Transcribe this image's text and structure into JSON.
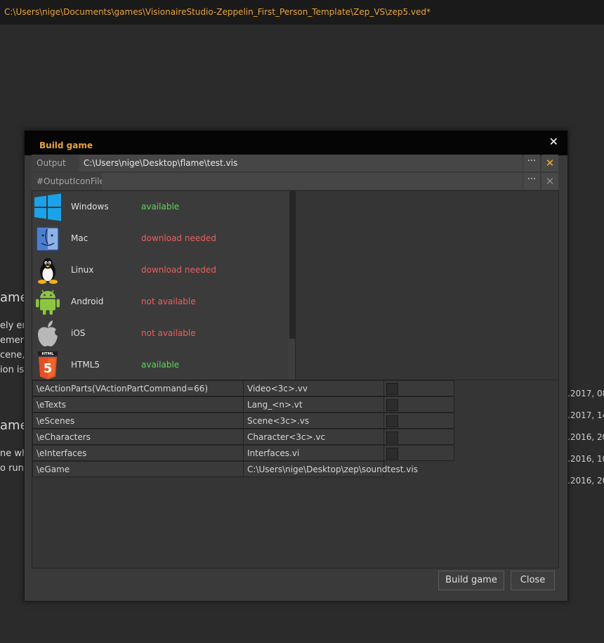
{
  "window": {
    "path": "C:\\Users\\nige\\Documents\\games\\VisionaireStudio-Zeppelin_First_Person_Template\\Zep_VS\\zep5.ved*"
  },
  "background": {
    "heading1": "ame",
    "lines1": [
      "ely em",
      "emen",
      "cene,",
      "ion is"
    ],
    "heading2": "ame",
    "lines2": [
      "ne wh",
      "o run"
    ],
    "dates": [
      ".2017, 08:",
      ".2017, 14:",
      ".2016, 20:",
      ".2016, 10:",
      ".2016, 20:"
    ]
  },
  "dialog": {
    "title": "Build game",
    "close_glyph": "✕",
    "output_file": {
      "label": "Output file",
      "value": "C:\\Users\\nige\\Desktop\\flame\\test.vis",
      "browse": "···",
      "clear": "✕"
    },
    "icon_file": {
      "label": "#OutputIconFile",
      "value": "",
      "browse": "···",
      "clear": "✕"
    },
    "platforms": [
      {
        "name": "Windows",
        "status": "available",
        "icon": "windows-icon"
      },
      {
        "name": "Mac",
        "status": "download needed",
        "icon": "mac-icon"
      },
      {
        "name": "Linux",
        "status": "download needed",
        "icon": "linux-icon"
      },
      {
        "name": "Android",
        "status": "not available",
        "icon": "android-icon"
      },
      {
        "name": "iOS",
        "status": "not available",
        "icon": "ios-icon"
      },
      {
        "name": "HTML5",
        "status": "available",
        "icon": "html5-icon"
      }
    ],
    "file_rows": [
      {
        "type": "\\eActionParts(VActionPartCommand=66)",
        "file": "Video<3c>.vv",
        "has_check": true
      },
      {
        "type": "\\eTexts",
        "file": "Lang_<n>.vt",
        "has_check": true
      },
      {
        "type": "\\eScenes",
        "file": "Scene<3c>.vs",
        "has_check": true
      },
      {
        "type": "\\eCharacters",
        "file": "Character<3c>.vc",
        "has_check": true
      },
      {
        "type": "\\eInterfaces",
        "file": "Interfaces.vi",
        "has_check": true
      },
      {
        "type": "\\eGame",
        "file": "C:\\Users\\nige\\Desktop\\zep\\soundtest.vis",
        "has_check": false
      }
    ],
    "buttons": {
      "build": "Build game",
      "close": "Close"
    }
  },
  "colors": {
    "accent": "#e8a43a",
    "available": "#5fd35f",
    "unavailable": "#e86060",
    "clear_active": "#f0b020",
    "clear_inactive": "#8a8a8a"
  }
}
